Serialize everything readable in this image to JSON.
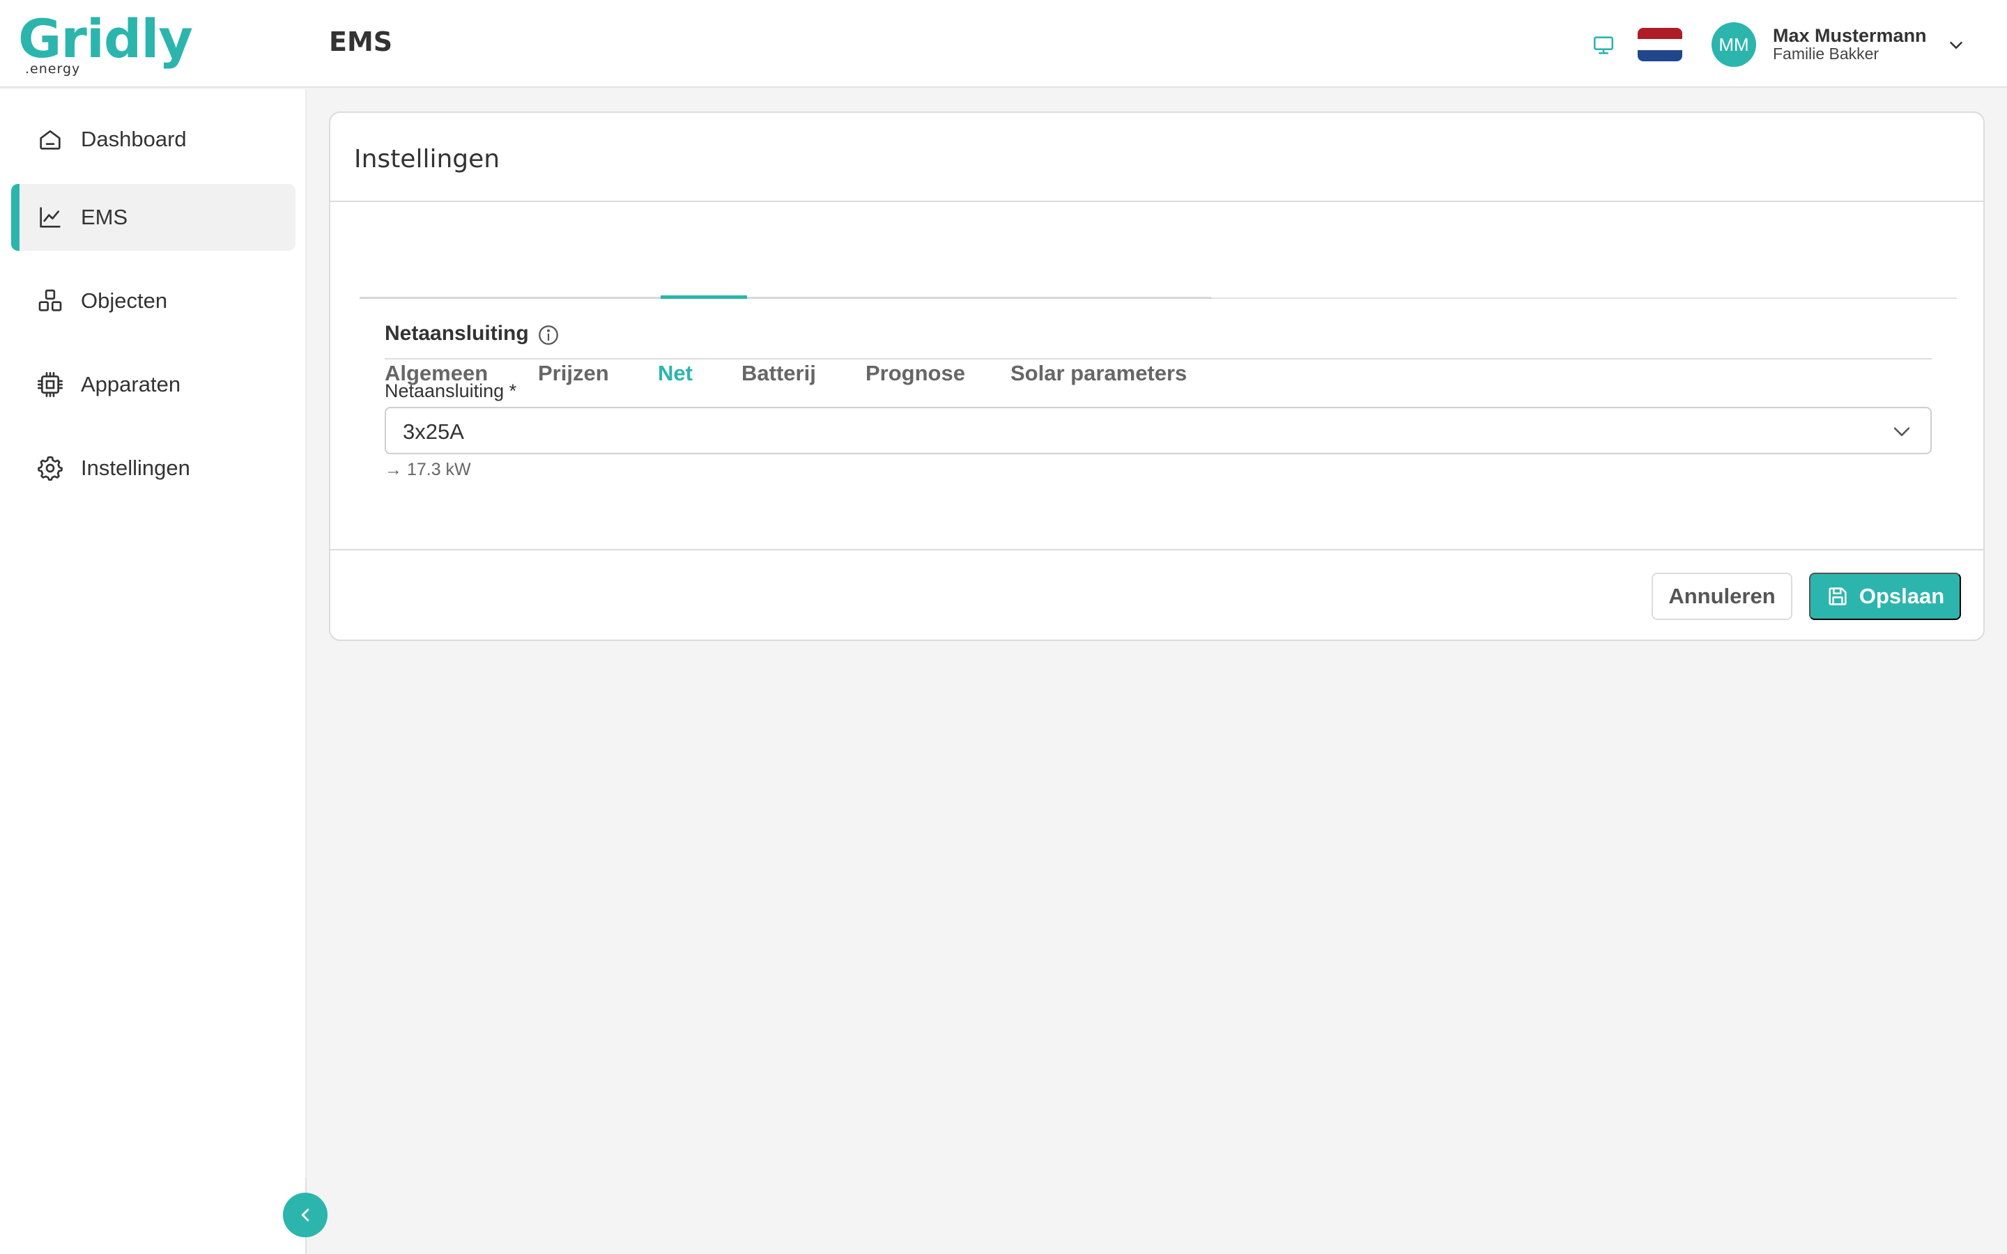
{
  "brand": {
    "name": "Gridly",
    "suffix": ".energy",
    "accent": "#2bb5ad"
  },
  "header": {
    "title": "EMS",
    "user": {
      "initials": "MM",
      "name": "Max Mustermann",
      "household": "Familie Bakker"
    },
    "icons": {
      "display": "monitor-icon",
      "language": "netherlands-flag-icon",
      "menu": "chevron-down-icon"
    }
  },
  "sidebar": {
    "items": [
      {
        "label": "Dashboard",
        "icon": "home-icon",
        "active": false
      },
      {
        "label": "EMS",
        "icon": "chart-line-icon",
        "active": true
      },
      {
        "label": "Objecten",
        "icon": "objects-icon",
        "active": false
      },
      {
        "label": "Apparaten",
        "icon": "chip-icon",
        "active": false
      },
      {
        "label": "Instellingen",
        "icon": "gear-icon",
        "active": false
      }
    ],
    "collapse_icon": "chevron-left-icon"
  },
  "settings": {
    "title": "Instellingen",
    "tabs": [
      {
        "label": "Algemeen",
        "active": false
      },
      {
        "label": "Prijzen",
        "active": false
      },
      {
        "label": "Net",
        "active": true
      },
      {
        "label": "Batterij",
        "active": false
      },
      {
        "label": "Prognose",
        "active": false
      },
      {
        "label": "Solar parameters",
        "active": false
      }
    ],
    "section": {
      "title": "Netaansluiting",
      "icon": "info-icon"
    },
    "field": {
      "label": "Netaansluiting *",
      "value": "3x25A",
      "hint": "→ 17.3 kW"
    },
    "actions": {
      "cancel": "Annuleren",
      "save": "Opslaan",
      "save_icon": "save-icon"
    }
  }
}
